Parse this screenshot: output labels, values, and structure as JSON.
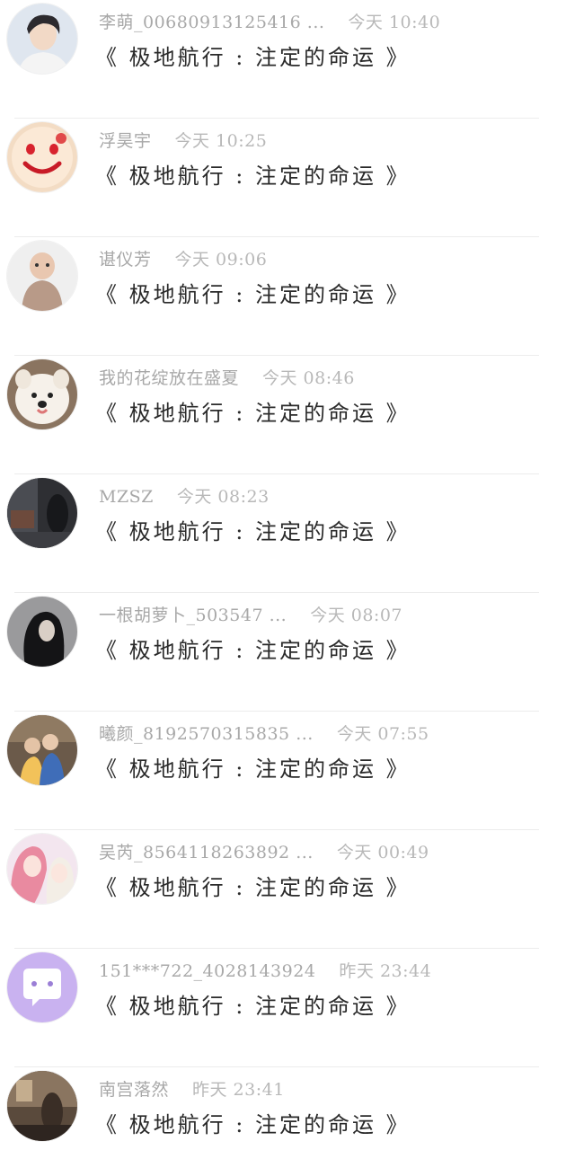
{
  "messages": [
    {
      "name": "李萌_00680913125416 ...",
      "time": "今天 10:40",
      "text": "《 极地航行 : 注定的命运 》",
      "avatar": "boy-photo-icon"
    },
    {
      "name": "浮昊宇",
      "time": "今天 10:25",
      "text": "《 极地航行 : 注定的命运 》",
      "avatar": "smiley-cake-icon"
    },
    {
      "name": "谌仪芳",
      "time": "今天 09:06",
      "text": "《 极地航行 : 注定的命运 》",
      "avatar": "baby-photo-icon"
    },
    {
      "name": "我的花绽放在盛夏",
      "time": "今天 08:46",
      "text": "《 极地航行 : 注定的命运 》",
      "avatar": "puppy-photo-icon"
    },
    {
      "name": "MZSZ",
      "time": "今天 08:23",
      "text": "《 极地航行 : 注定的命运 》",
      "avatar": "street-photo-icon"
    },
    {
      "name": "一根胡萝卜_503547 ...",
      "time": "今天 08:07",
      "text": "《 极地航行 : 注定的命运 》",
      "avatar": "girl-silhouette-icon"
    },
    {
      "name": "曦颜_8192570315835 ...",
      "time": "今天 07:55",
      "text": "《 极地航行 : 注定的命运 》",
      "avatar": "couple-photo-icon"
    },
    {
      "name": "吴芮_8564118263892 ...",
      "time": "今天 00:49",
      "text": "《 极地航行 : 注定的命运 》",
      "avatar": "anime-girls-icon"
    },
    {
      "name": "151***722_4028143924",
      "time": "昨天 23:44",
      "text": "《 极地航行 : 注定的命运 》",
      "avatar": "chat-bubble-icon"
    },
    {
      "name": "南宫落然",
      "time": "昨天 23:41",
      "text": "《 极地航行 : 注定的命运 》",
      "avatar": "room-photo-icon"
    }
  ],
  "colors": {
    "meta": "#a8a8a8",
    "text": "#2a2a2a",
    "divider": "#ececec",
    "chatBubbleBg": "#c9b2f0"
  }
}
